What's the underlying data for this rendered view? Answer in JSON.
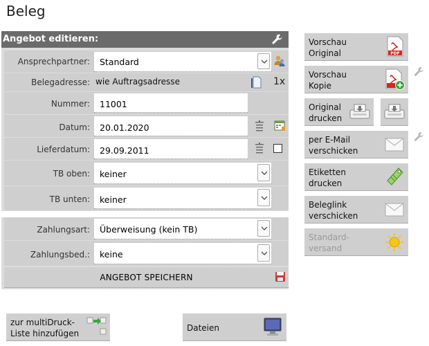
{
  "page": {
    "title": "Beleg"
  },
  "panel": {
    "header": "Angebot editieren:"
  },
  "form": {
    "ansprechpartner": {
      "label": "Ansprechpartner:",
      "value": "Standard"
    },
    "belegadresse": {
      "label": "Belegadresse:",
      "value": "wie Auftragsadresse",
      "copies": "1x"
    },
    "nummer": {
      "label": "Nummer:",
      "value": "11001"
    },
    "datum": {
      "label": "Datum:",
      "value": "20.01.2020"
    },
    "lieferdatum": {
      "label": "Lieferdatum:",
      "value": "29.09.2011",
      "checked": false
    },
    "tb_oben": {
      "label": "TB oben:",
      "value": "keiner"
    },
    "tb_unten": {
      "label": "TB unten:",
      "value": "keiner"
    },
    "zahlungsart": {
      "label": "Zahlungsart:",
      "value": "Überweisung (kein TB)"
    },
    "zahlungsbed": {
      "label": "Zahlungsbed.:",
      "value": "keine"
    },
    "save_label": "ANGEBOT SPEICHERN"
  },
  "actions": {
    "vorschau_original": [
      "Vorschau",
      "Original"
    ],
    "vorschau_kopie": [
      "Vorschau",
      "Kopie"
    ],
    "original_drucken": [
      "Original",
      "drucken"
    ],
    "per_email": [
      "per E-Mail",
      "verschicken"
    ],
    "etiketten": [
      "Etiketten",
      "drucken"
    ],
    "beleglink": [
      "Beleglink",
      "verschicken"
    ],
    "standardversand": [
      "Standard-",
      "versand"
    ],
    "multidruck": [
      "zur multiDruck-",
      "Liste hinzufügen"
    ],
    "dateien": "Dateien"
  },
  "icons": {
    "pdf_label": "PDF",
    "pdf_color": "#d9251d",
    "accent_green": "#3aa53a"
  }
}
